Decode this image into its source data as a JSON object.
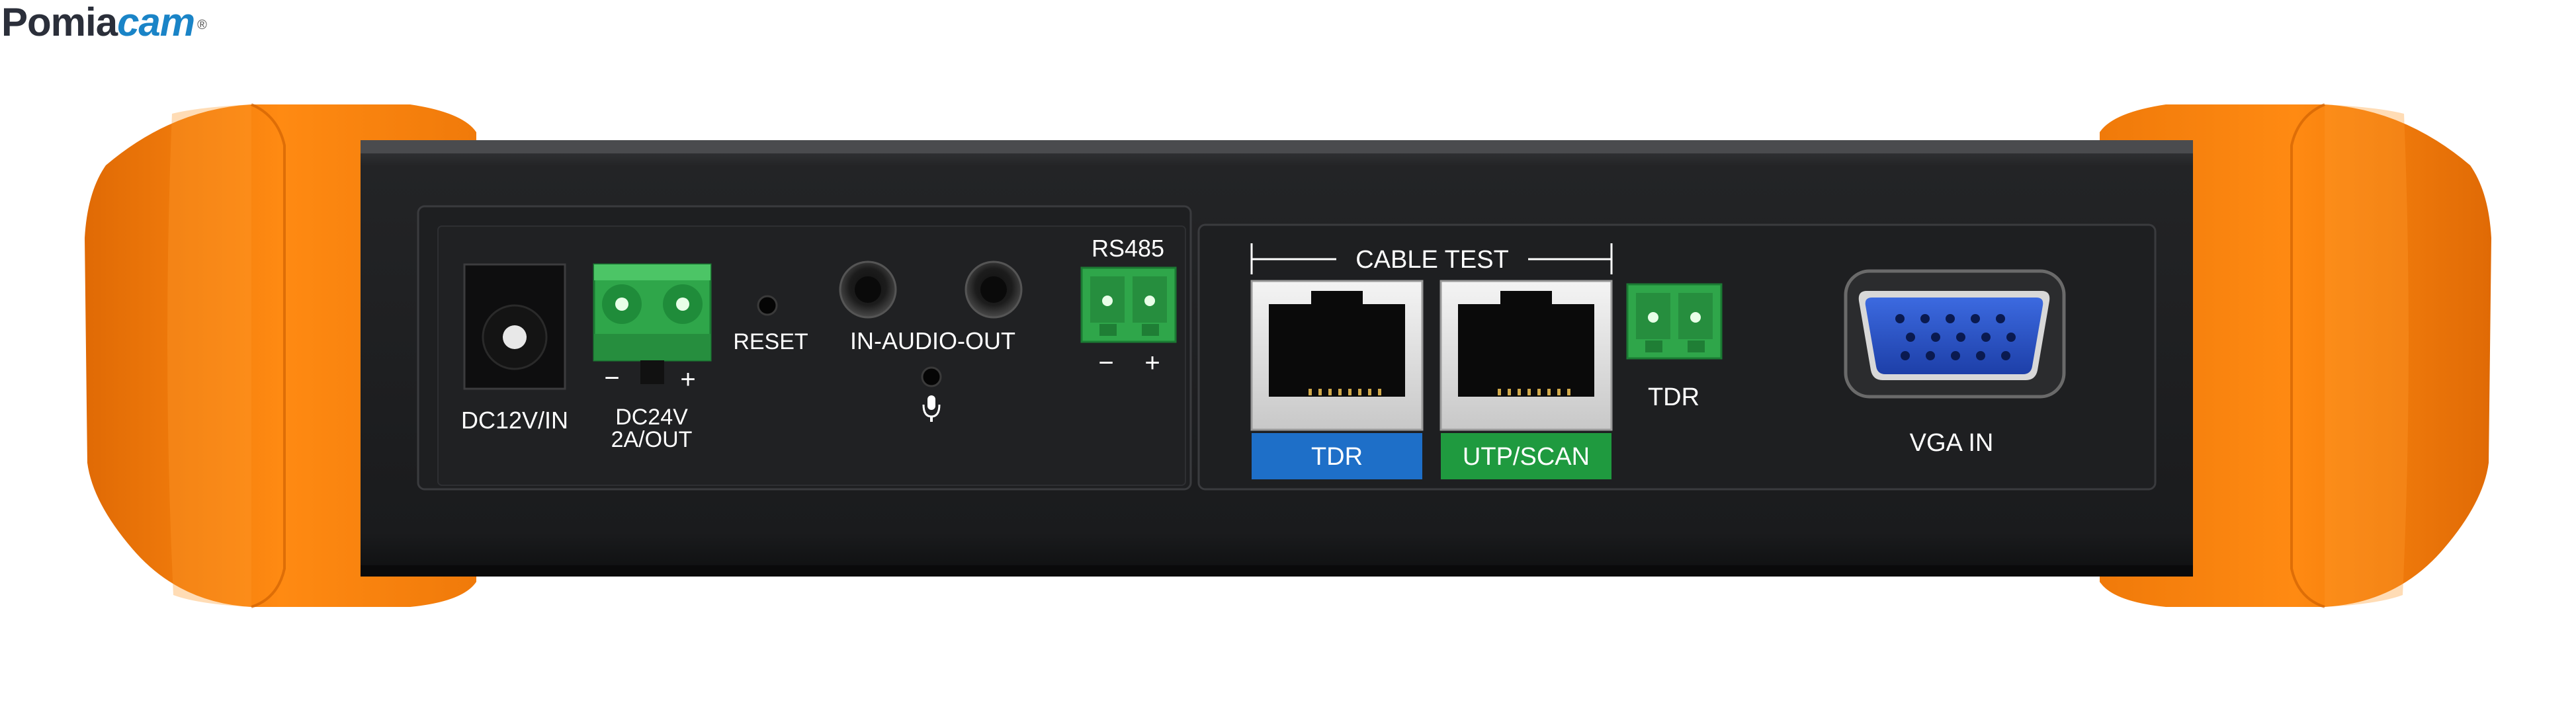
{
  "brand": {
    "name_part1": "Pomia",
    "name_part2": "cam",
    "registered_mark": "®"
  },
  "panel_left": {
    "dc_in_label": "DC12V/IN",
    "dc_out_label_line1": "DC24V",
    "dc_out_label_line2": "2A/OUT",
    "dc_out_minus": "−",
    "dc_out_plus": "+",
    "reset_label": "RESET",
    "audio_label": "IN-AUDIO-OUT",
    "rs485_label": "RS485",
    "rs485_minus": "−",
    "rs485_plus": "+"
  },
  "panel_right": {
    "cable_test_label": "CABLE TEST",
    "tdr_port_label": "TDR",
    "utp_port_label": "UTP/SCAN",
    "tdr_terminal_label": "TDR",
    "vga_label": "VGA IN"
  },
  "colors": {
    "body": "#1d1e20",
    "bumper": "#f08010",
    "terminal_green": "#2fa64a",
    "tdr_label_bg": "#1e6fc8",
    "utp_label_bg": "#1f9a3f",
    "vga_blue": "#2a55c8"
  },
  "icons": [
    "microphone-icon",
    "rj45-port-icon",
    "vga-port-icon",
    "terminal-block-icon",
    "dc-jack-icon",
    "audio-jack-icon",
    "reset-hole-icon"
  ]
}
